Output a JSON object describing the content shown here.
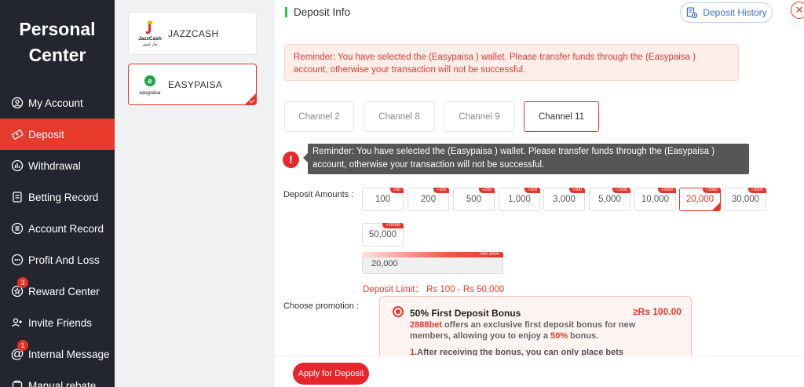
{
  "sidebar": {
    "title": "Personal Center",
    "items": [
      {
        "label": "My Account",
        "icon": "user-circle-icon"
      },
      {
        "label": "Deposit",
        "icon": "deposit-icon",
        "active": true
      },
      {
        "label": "Withdrawal",
        "icon": "withdrawal-icon"
      },
      {
        "label": "Betting Record",
        "icon": "betting-record-icon"
      },
      {
        "label": "Account Record",
        "icon": "account-record-icon"
      },
      {
        "label": "Profit And Loss",
        "icon": "profit-loss-icon"
      },
      {
        "label": "Reward Center",
        "icon": "reward-icon",
        "badge": "3"
      },
      {
        "label": "Invite Friends",
        "icon": "invite-friends-icon"
      },
      {
        "label": "Internal Message",
        "icon": "at-sign-icon",
        "badge": "1"
      },
      {
        "label": "Manual rebate",
        "icon": "rebate-icon"
      }
    ]
  },
  "wallets": [
    {
      "name": "JAZZCASH",
      "logo_text": "JazzCash",
      "logo_sub": "جاز کیش",
      "selected": false
    },
    {
      "name": "EASYPAISA",
      "logo_text": "easypaisa",
      "selected": true
    }
  ],
  "header": {
    "title": "Deposit Info",
    "history_label": "Deposit History",
    "close_label": "✕"
  },
  "reminder": "Reminder: You have selected the (Easypaisa ) wallet. Please transfer funds through the (Easypaisa ) account, otherwise your transaction will not be successful.",
  "tooltip": "Reminder: You have selected the (Easypaisa ) wallet. Please transfer funds through the (Easypaisa ) account, otherwise your transaction will not be successful.",
  "warn_icon": "!",
  "channels": [
    {
      "label": "Channel 2",
      "selected": false
    },
    {
      "label": "Channel 8",
      "selected": false
    },
    {
      "label": "Channel 9",
      "selected": false
    },
    {
      "label": "Channel 11",
      "selected": true
    }
  ],
  "deposit_amounts_label": "Deposit Amounts :",
  "amounts": [
    {
      "value": "100",
      "bonus": "+50"
    },
    {
      "value": "200",
      "bonus": "+100"
    },
    {
      "value": "500",
      "bonus": "+200"
    },
    {
      "value": "1,000",
      "bonus": "+300"
    },
    {
      "value": "3,000",
      "bonus": "+300"
    },
    {
      "value": "5,000",
      "bonus": "+1500"
    },
    {
      "value": "10,000",
      "bonus": "+3000"
    },
    {
      "value": "20,000",
      "bonus": "+3000",
      "selected": true
    },
    {
      "value": "30,000",
      "bonus": "+3000"
    },
    {
      "value": "50,000",
      "bonus": "+20000"
    }
  ],
  "amount_input": {
    "value": "20,000",
    "bonus_text": "+Rs 3000"
  },
  "deposit_limit": "Deposit Limit： Rs  100  -  Rs  50,000",
  "choose_promotion_label": "Choose promotion :",
  "promotion": {
    "title": "50% First Deposit Bonus",
    "min_amount": "≥Rs  100.00",
    "brand": "2888bet",
    "desc_1": " offers an exclusive first deposit bonus for new members, allowing you to enjoy a ",
    "percent": "50%",
    "desc_2": " bonus.",
    "step_num": "1",
    "step_text": ".After receiving the bonus, you can only place bets"
  },
  "apply_label": "Apply for Deposit",
  "colors": {
    "accent": "#e6342a",
    "sidebar_bg": "#23262f",
    "header_mark": "#27c93f",
    "history_blue": "#3b6fc9"
  }
}
